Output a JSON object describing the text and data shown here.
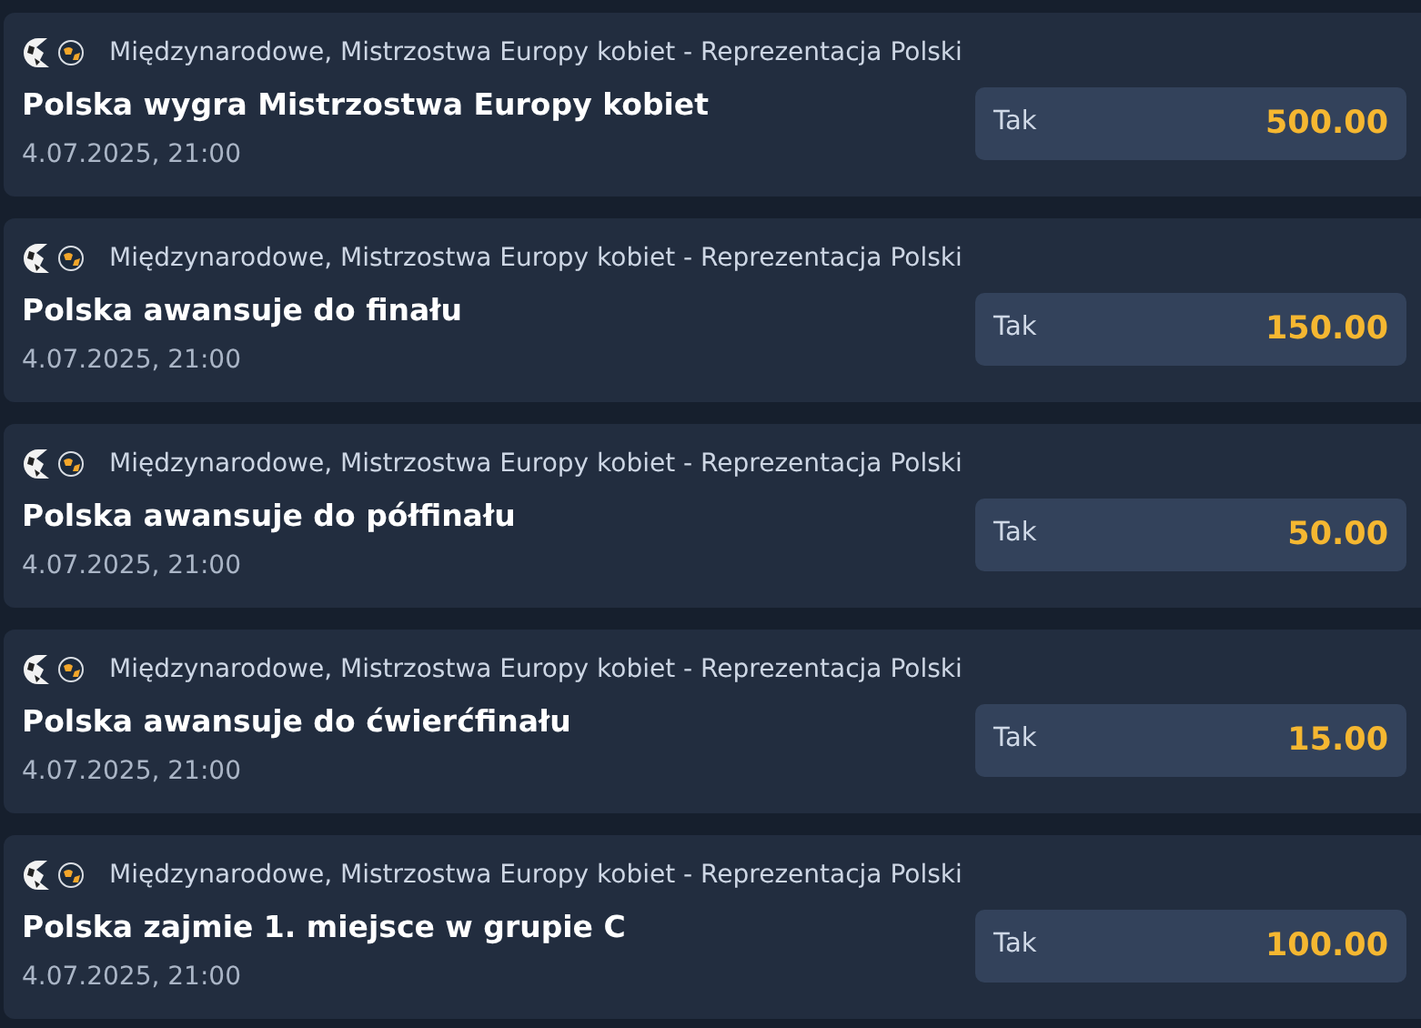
{
  "bets": [
    {
      "league": "Międzynarodowe, Mistrzostwa Europy kobiet - Reprezentacja Polski",
      "title": "Polska wygra Mistrzostwa Europy kobiet",
      "date": "4.07.2025, 21:00",
      "outcome": "Tak",
      "odds": "500.00"
    },
    {
      "league": "Międzynarodowe, Mistrzostwa Europy kobiet - Reprezentacja Polski",
      "title": "Polska awansuje do finału",
      "date": "4.07.2025, 21:00",
      "outcome": "Tak",
      "odds": "150.00"
    },
    {
      "league": "Międzynarodowe, Mistrzostwa Europy kobiet - Reprezentacja Polski",
      "title": "Polska awansuje do półfinału",
      "date": "4.07.2025, 21:00",
      "outcome": "Tak",
      "odds": "50.00"
    },
    {
      "league": "Międzynarodowe, Mistrzostwa Europy kobiet - Reprezentacja Polski",
      "title": "Polska awansuje do ćwierćfinału",
      "date": "4.07.2025, 21:00",
      "outcome": "Tak",
      "odds": "15.00"
    },
    {
      "league": "Międzynarodowe, Mistrzostwa Europy kobiet - Reprezentacja Polski",
      "title": "Polska zajmie 1. miejsce w grupie C",
      "date": "4.07.2025, 21:00",
      "outcome": "Tak",
      "odds": "100.00"
    }
  ]
}
